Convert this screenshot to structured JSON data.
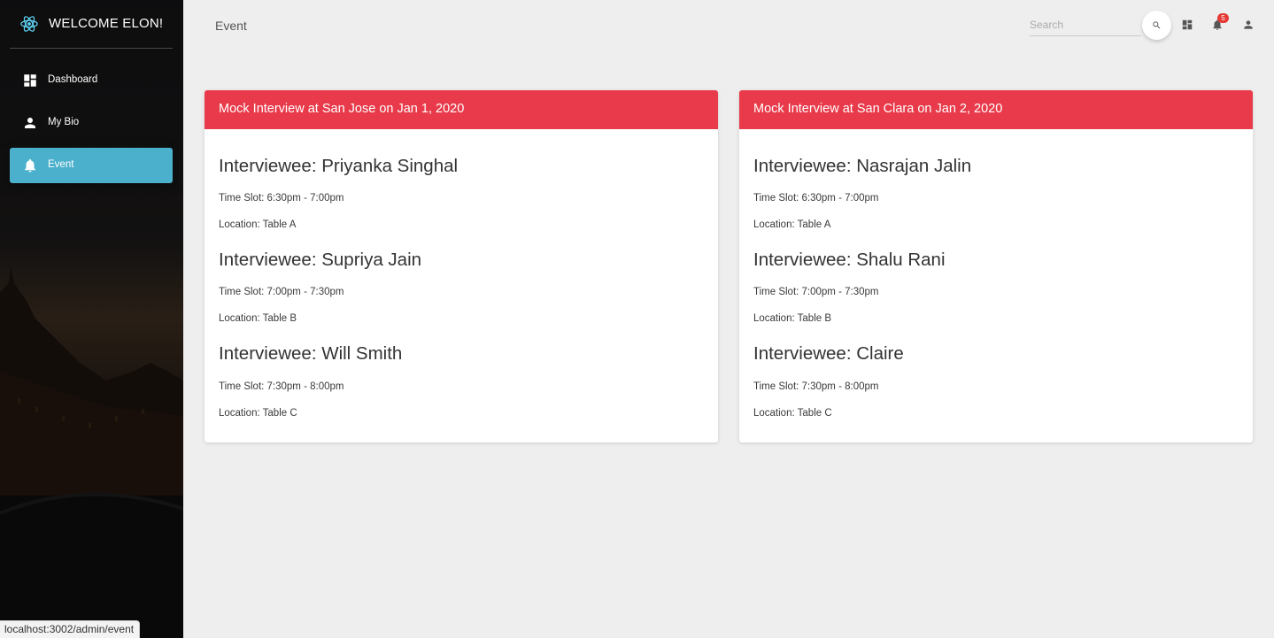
{
  "sidebar": {
    "title": "WELCOME ELON!",
    "items": [
      {
        "label": "Dashboard",
        "icon": "dashboard-icon"
      },
      {
        "label": "My Bio",
        "icon": "person-icon"
      },
      {
        "label": "Event",
        "icon": "bell-icon",
        "active": true
      }
    ]
  },
  "status_bar": {
    "url": "localhost:3002/admin/event"
  },
  "topbar": {
    "title": "Event",
    "search_placeholder": "Search",
    "notification_count": "5"
  },
  "colors": {
    "accent": "#4bb0cb",
    "card_header": "#e83a4a"
  },
  "events": [
    {
      "title": "Mock Interview at San Jose on Jan 1, 2020",
      "entries": [
        {
          "name": "Interviewee: Priyanka Singhal",
          "time": "Time Slot: 6:30pm - 7:00pm",
          "location": "Location: Table A"
        },
        {
          "name": "Interviewee: Supriya Jain",
          "time": "Time Slot: 7:00pm - 7:30pm",
          "location": "Location: Table B"
        },
        {
          "name": "Interviewee: Will Smith",
          "time": "Time Slot: 7:30pm - 8:00pm",
          "location": "Location: Table C"
        }
      ]
    },
    {
      "title": "Mock Interview at San Clara on Jan 2, 2020",
      "entries": [
        {
          "name": "Interviewee: Nasrajan Jalin",
          "time": "Time Slot: 6:30pm - 7:00pm",
          "location": "Location: Table A"
        },
        {
          "name": "Interviewee: Shalu Rani",
          "time": "Time Slot: 7:00pm - 7:30pm",
          "location": "Location: Table B"
        },
        {
          "name": "Interviewee: Claire",
          "time": "Time Slot: 7:30pm - 8:00pm",
          "location": "Location: Table C"
        }
      ]
    }
  ]
}
